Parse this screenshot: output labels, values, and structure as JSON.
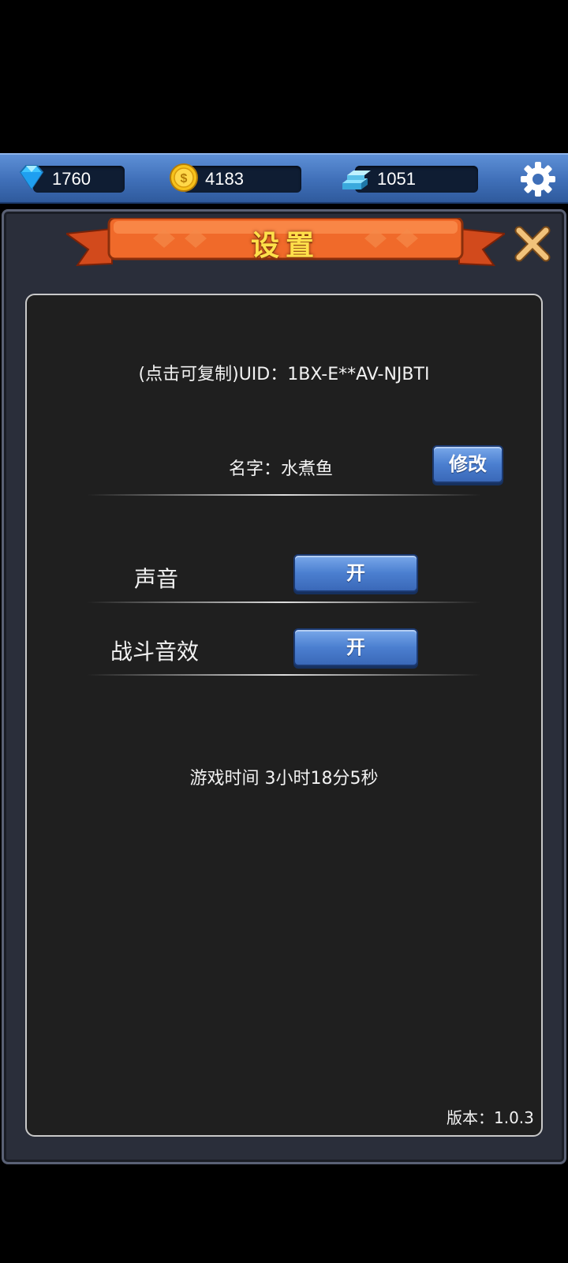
{
  "resources": {
    "gems": {
      "value": "1760",
      "icon": "diamond-icon"
    },
    "coins": {
      "value": "4183",
      "icon": "gold-coin-icon"
    },
    "ingots": {
      "value": "1051",
      "icon": "blue-ingot-icon"
    }
  },
  "settings": {
    "title": "设置",
    "uid_text": "(点击可复制)UID：1BX-E**AV-NJBTI",
    "name_text": "名字：水煮鱼",
    "edit_label": "修改",
    "sound_label": "声音",
    "sound_toggle": "开",
    "battle_sound_label": "战斗音效",
    "battle_sound_toggle": "开",
    "playtime": "游戏时间 3小时18分5秒",
    "version": "版本：1.0.3"
  },
  "colors": {
    "accent_blue": "#4b7fd0",
    "ribbon_orange": "#f06a2a",
    "title_yellow": "#ffe04a",
    "panel_bg": "#1f1f1f"
  }
}
